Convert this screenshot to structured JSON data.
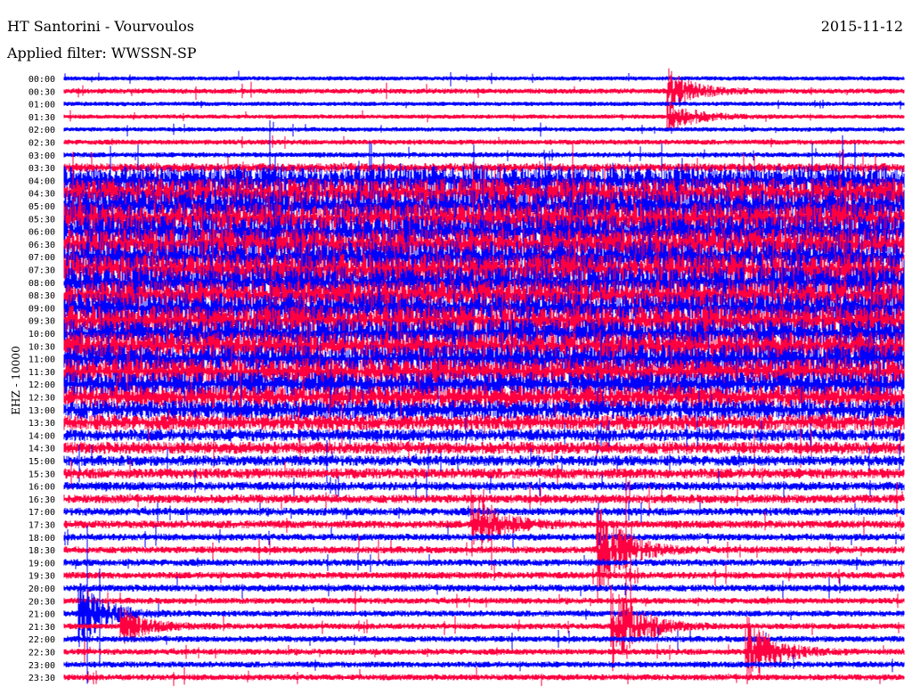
{
  "header": {
    "title": "HT Santorini - Vourvoulos",
    "filter": "Applied filter: WWSSN-SP",
    "date": "2015-11-12",
    "channel": "EHZ - 10000"
  },
  "chart_data": {
    "type": "line",
    "subtype": "helicorder",
    "title": "HT Santorini - Vourvoulos",
    "ylabel": "EHZ - 10000",
    "row_minutes": 30,
    "colors": {
      "even": "#0000ff",
      "odd": "#ff0040"
    },
    "rows": [
      "00:00",
      "00:30",
      "01:00",
      "01:30",
      "02:00",
      "02:30",
      "03:00",
      "03:30",
      "04:00",
      "04:30",
      "05:00",
      "05:30",
      "06:00",
      "06:30",
      "07:00",
      "07:30",
      "08:00",
      "08:30",
      "09:00",
      "09:30",
      "10:00",
      "10:30",
      "11:00",
      "11:30",
      "12:00",
      "12:30",
      "13:00",
      "13:30",
      "14:00",
      "14:30",
      "15:00",
      "15:30",
      "16:00",
      "16:30",
      "17:00",
      "17:30",
      "18:00",
      "18:30",
      "19:00",
      "19:30",
      "20:00",
      "20:30",
      "21:00",
      "21:30",
      "22:00",
      "22:30",
      "23:00",
      "23:30"
    ],
    "relative_amplitude": [
      3,
      4,
      3,
      3,
      3,
      4,
      4,
      8,
      30,
      32,
      34,
      34,
      34,
      34,
      34,
      34,
      34,
      32,
      32,
      32,
      30,
      30,
      30,
      28,
      26,
      24,
      20,
      16,
      12,
      12,
      10,
      10,
      8,
      8,
      7,
      7,
      6,
      6,
      6,
      6,
      6,
      5,
      5,
      5,
      5,
      5,
      5,
      5
    ],
    "events": [
      {
        "row": 42,
        "minute": 0.5,
        "amplitude": 40
      },
      {
        "row": 43,
        "minute": 19.5,
        "amplitude": 60
      },
      {
        "row": 43,
        "minute": 2.0,
        "amplitude": 20
      },
      {
        "row": 45,
        "minute": 24.3,
        "amplitude": 45
      },
      {
        "row": 1,
        "minute": 21.5,
        "amplitude": 25
      },
      {
        "row": 3,
        "minute": 21.5,
        "amplitude": 20
      },
      {
        "row": 35,
        "minute": 14.5,
        "amplitude": 40
      },
      {
        "row": 37,
        "minute": 19.0,
        "amplitude": 60
      }
    ]
  }
}
